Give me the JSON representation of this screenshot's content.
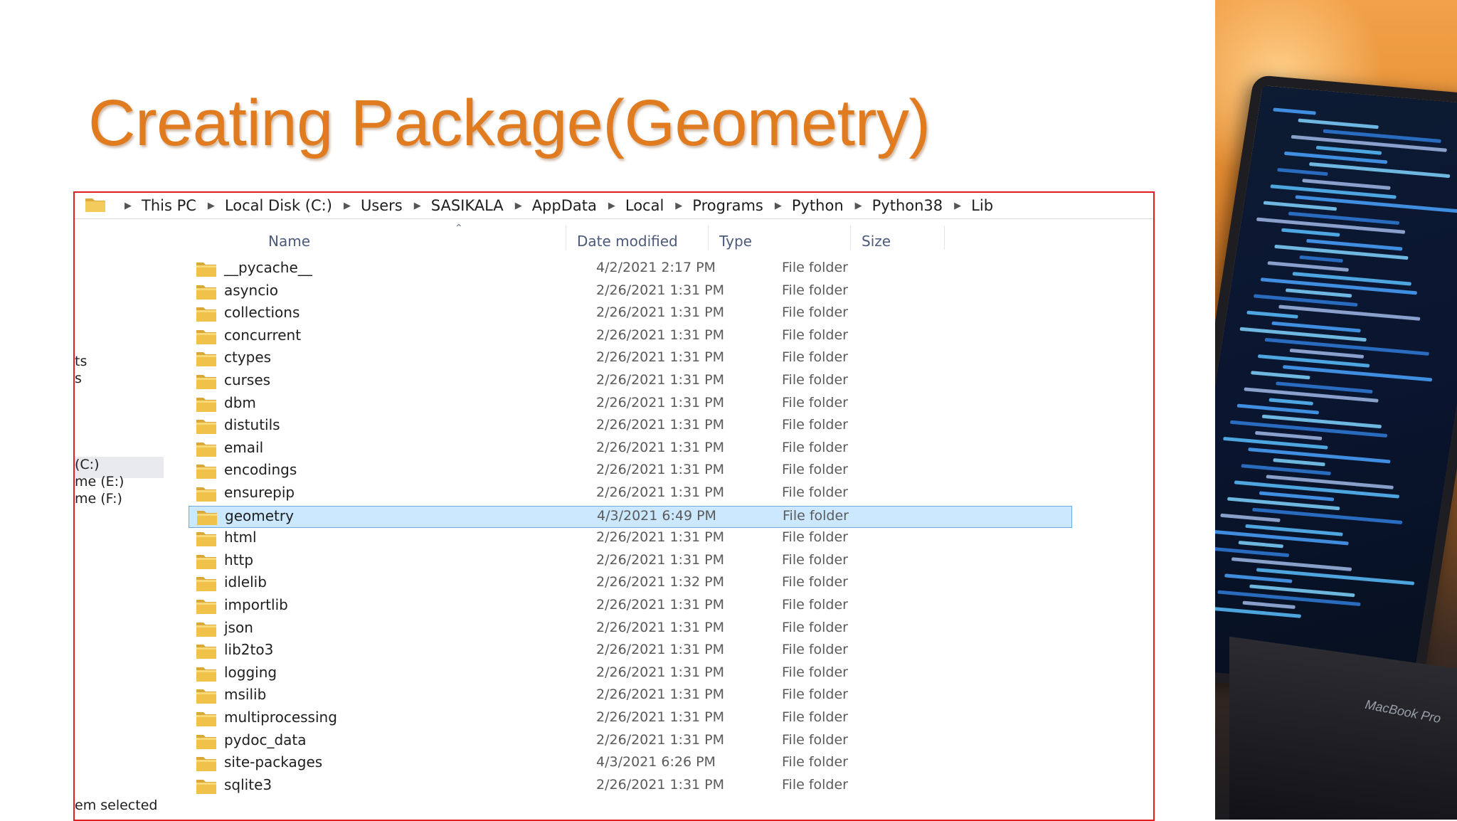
{
  "slide": {
    "title": "Creating Package(Geometry)"
  },
  "breadcrumb": [
    "This PC",
    "Local Disk (C:)",
    "Users",
    "SASIKALA",
    "AppData",
    "Local",
    "Programs",
    "Python",
    "Python38",
    "Lib"
  ],
  "columns": {
    "name": "Name",
    "date": "Date modified",
    "type": "Type",
    "size": "Size"
  },
  "nav": {
    "items": [
      "ts",
      "s",
      "(C:)",
      "me (E:)",
      "me (F:)"
    ],
    "selected_index": 2
  },
  "files": [
    {
      "name": "__pycache__",
      "date": "4/2/2021 2:17 PM",
      "type": "File folder"
    },
    {
      "name": "asyncio",
      "date": "2/26/2021 1:31 PM",
      "type": "File folder"
    },
    {
      "name": "collections",
      "date": "2/26/2021 1:31 PM",
      "type": "File folder"
    },
    {
      "name": "concurrent",
      "date": "2/26/2021 1:31 PM",
      "type": "File folder"
    },
    {
      "name": "ctypes",
      "date": "2/26/2021 1:31 PM",
      "type": "File folder"
    },
    {
      "name": "curses",
      "date": "2/26/2021 1:31 PM",
      "type": "File folder"
    },
    {
      "name": "dbm",
      "date": "2/26/2021 1:31 PM",
      "type": "File folder"
    },
    {
      "name": "distutils",
      "date": "2/26/2021 1:31 PM",
      "type": "File folder"
    },
    {
      "name": "email",
      "date": "2/26/2021 1:31 PM",
      "type": "File folder"
    },
    {
      "name": "encodings",
      "date": "2/26/2021 1:31 PM",
      "type": "File folder"
    },
    {
      "name": "ensurepip",
      "date": "2/26/2021 1:31 PM",
      "type": "File folder"
    },
    {
      "name": "geometry",
      "date": "4/3/2021 6:49 PM",
      "type": "File folder"
    },
    {
      "name": "html",
      "date": "2/26/2021 1:31 PM",
      "type": "File folder"
    },
    {
      "name": "http",
      "date": "2/26/2021 1:31 PM",
      "type": "File folder"
    },
    {
      "name": "idlelib",
      "date": "2/26/2021 1:32 PM",
      "type": "File folder"
    },
    {
      "name": "importlib",
      "date": "2/26/2021 1:31 PM",
      "type": "File folder"
    },
    {
      "name": "json",
      "date": "2/26/2021 1:31 PM",
      "type": "File folder"
    },
    {
      "name": "lib2to3",
      "date": "2/26/2021 1:31 PM",
      "type": "File folder"
    },
    {
      "name": "logging",
      "date": "2/26/2021 1:31 PM",
      "type": "File folder"
    },
    {
      "name": "msilib",
      "date": "2/26/2021 1:31 PM",
      "type": "File folder"
    },
    {
      "name": "multiprocessing",
      "date": "2/26/2021 1:31 PM",
      "type": "File folder"
    },
    {
      "name": "pydoc_data",
      "date": "2/26/2021 1:31 PM",
      "type": "File folder"
    },
    {
      "name": "site-packages",
      "date": "4/3/2021 6:26 PM",
      "type": "File folder"
    },
    {
      "name": "sqlite3",
      "date": "2/26/2021 1:31 PM",
      "type": "File folder"
    }
  ],
  "selected_file": "geometry",
  "status": {
    "text": "em selected"
  },
  "photo": {
    "label": "MacBook Pro"
  },
  "colors": {
    "title": "#e07b1f",
    "frame": "#e02020",
    "selection": "#cce8ff",
    "folder": "#f0c24a"
  }
}
